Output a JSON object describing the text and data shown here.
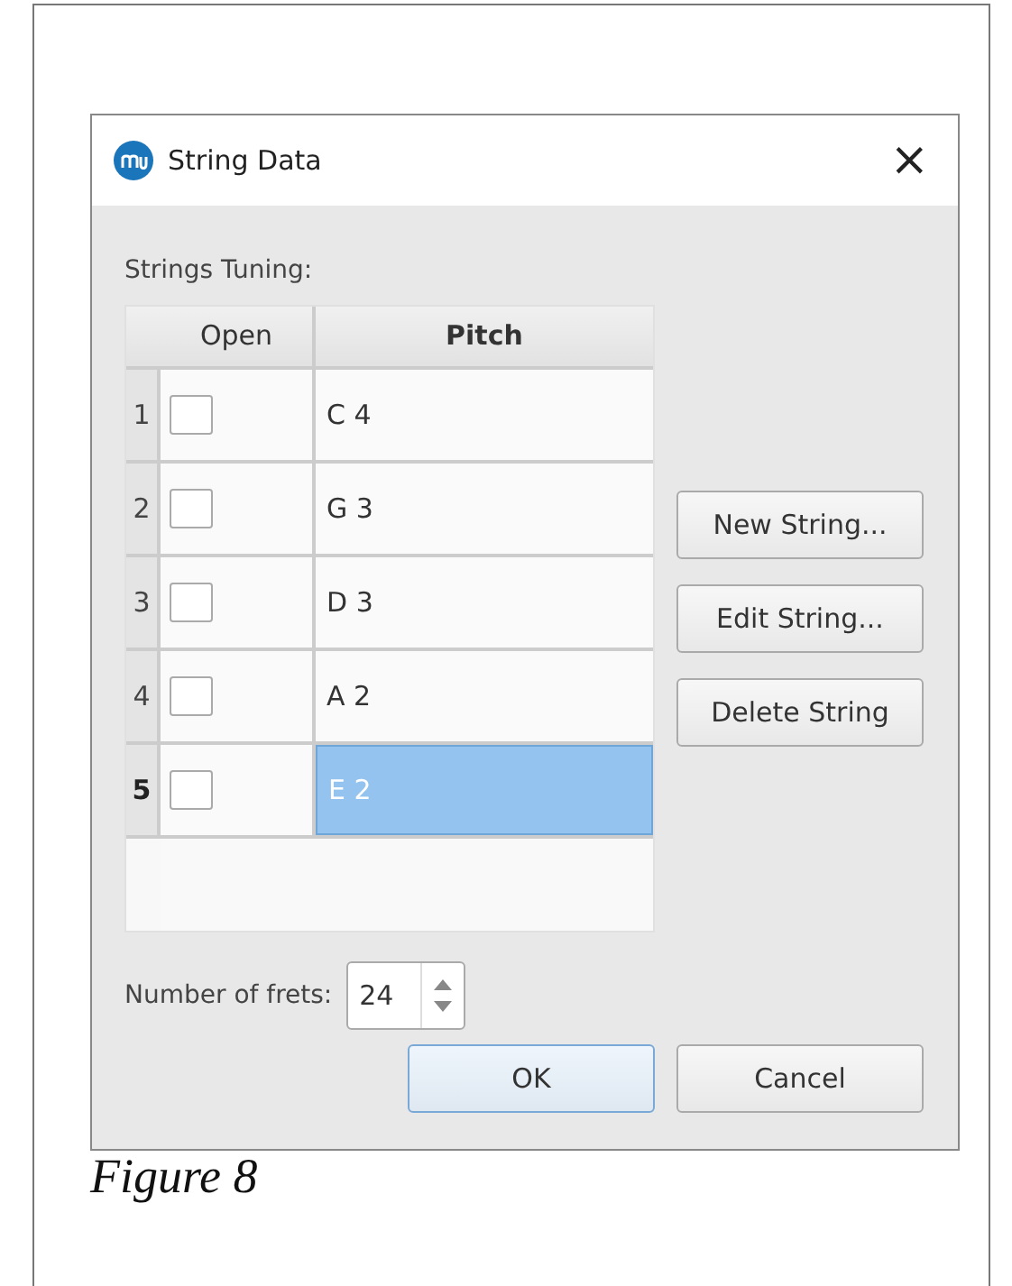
{
  "dialog": {
    "title": "String Data",
    "close": "×"
  },
  "strings_label": "Strings Tuning:",
  "table": {
    "columns": [
      "Open",
      "Pitch"
    ],
    "rows": [
      {
        "number": "1",
        "open": false,
        "pitch": "C 4",
        "selected": false
      },
      {
        "number": "2",
        "open": false,
        "pitch": "G 3",
        "selected": false
      },
      {
        "number": "3",
        "open": false,
        "pitch": "D 3",
        "selected": false
      },
      {
        "number": "4",
        "open": false,
        "pitch": "A 2",
        "selected": false
      },
      {
        "number": "5",
        "open": false,
        "pitch": "E 2",
        "selected": true
      }
    ]
  },
  "side_buttons": [
    "New String...",
    "Edit String...",
    "Delete String"
  ],
  "frets": {
    "label": "Number of frets:",
    "value": "24"
  },
  "footer_buttons": [
    {
      "label": "OK",
      "default": true
    },
    {
      "label": "Cancel",
      "default": false
    }
  ],
  "caption": "Figure 8"
}
